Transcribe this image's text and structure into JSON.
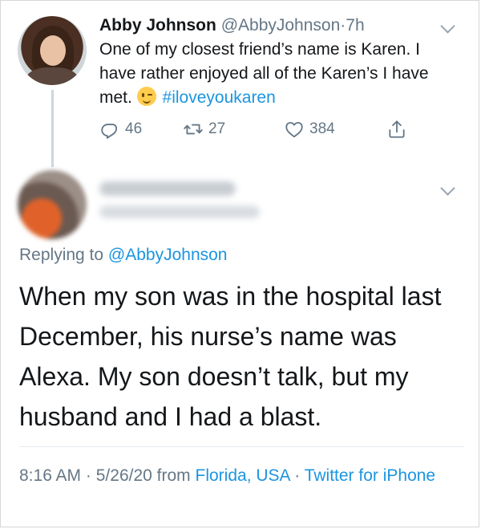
{
  "tweet": {
    "display_name": "Abby Johnson",
    "handle": "@AbbyJohnson",
    "separator": "·",
    "time": "7h",
    "text_part1": "One of my closest friend’s name is Karen. I have rather enjoyed all of the Karen’s I have met.",
    "emoji": "winking-face",
    "hashtag": "#iloveyoukaren",
    "replies": "46",
    "retweets": "27",
    "likes": "384"
  },
  "reply": {
    "replying_prefix": "Replying to",
    "replying_handle": "@AbbyJohnson",
    "text": "When my son was in the hospital last December, his nurse’s name was Alexa. My son doesn’t talk, but my husband and I had a blast.",
    "time": "8:16 AM",
    "sep1": "·",
    "date_from": "5/26/20 from",
    "location": "Florida, USA",
    "sep2": "·",
    "client": "Twitter for iPhone"
  },
  "colors": {
    "link": "#1b95e0",
    "meta": "#657786",
    "text": "#14171a"
  }
}
